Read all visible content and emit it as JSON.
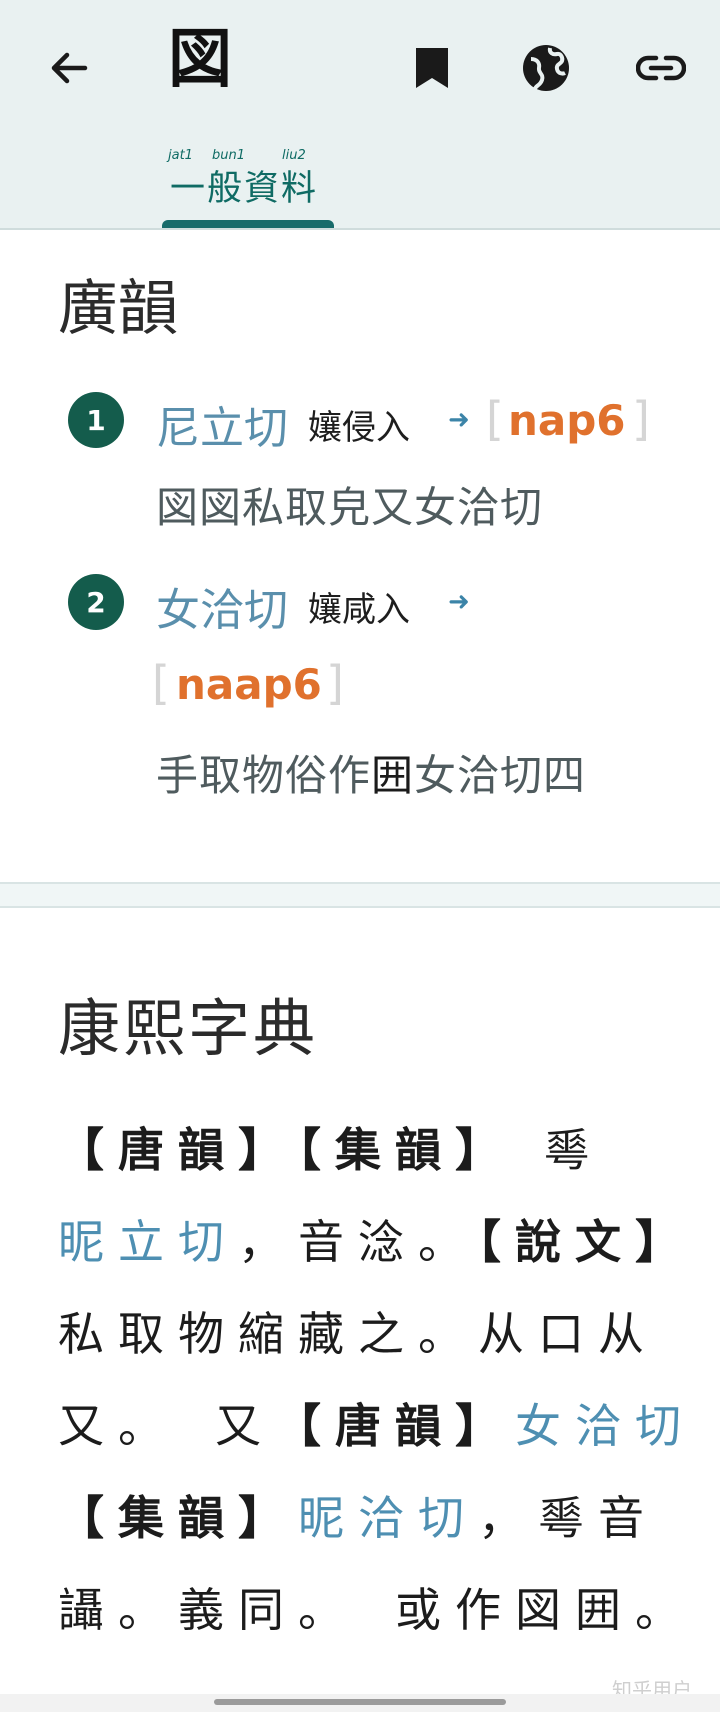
{
  "header": {
    "title": "図",
    "tab": {
      "romanization": [
        "jat1",
        "bun1",
        "liu2"
      ],
      "label": "一般資料"
    }
  },
  "guangyun": {
    "title": "廣韻",
    "entries": [
      {
        "number": "1",
        "fanqie": "尼立切",
        "tone": "孃侵入",
        "arrow": "➜",
        "open_bracket": "[",
        "jyutping": "nap6",
        "close_bracket": "]",
        "gloss": "図図私取皃又女洽切"
      },
      {
        "number": "2",
        "fanqie": "女洽切",
        "tone": "孃咸入",
        "arrow": "➜",
        "open_bracket": "[",
        "jyutping": "naap6",
        "close_bracket": "]",
        "gloss_parts": [
          "手取物俗作",
          "囲",
          "女洽切四"
        ]
      }
    ]
  },
  "kangxi": {
    "title": "康熙字典",
    "lines": [
      [
        "【唐韻】【集韻】",
        "𠌶"
      ],
      [
        "昵立切",
        "，音淰。",
        "【說文】"
      ],
      [
        "私取物縮藏之。从口从"
      ],
      [
        "又。　又",
        "【唐韻】",
        "女洽切"
      ],
      [
        "【集韻】",
        "昵洽切",
        "，𠌶音"
      ],
      [
        "讘。義同。　或作図囲。"
      ]
    ]
  },
  "watermark": "知乎用户"
}
